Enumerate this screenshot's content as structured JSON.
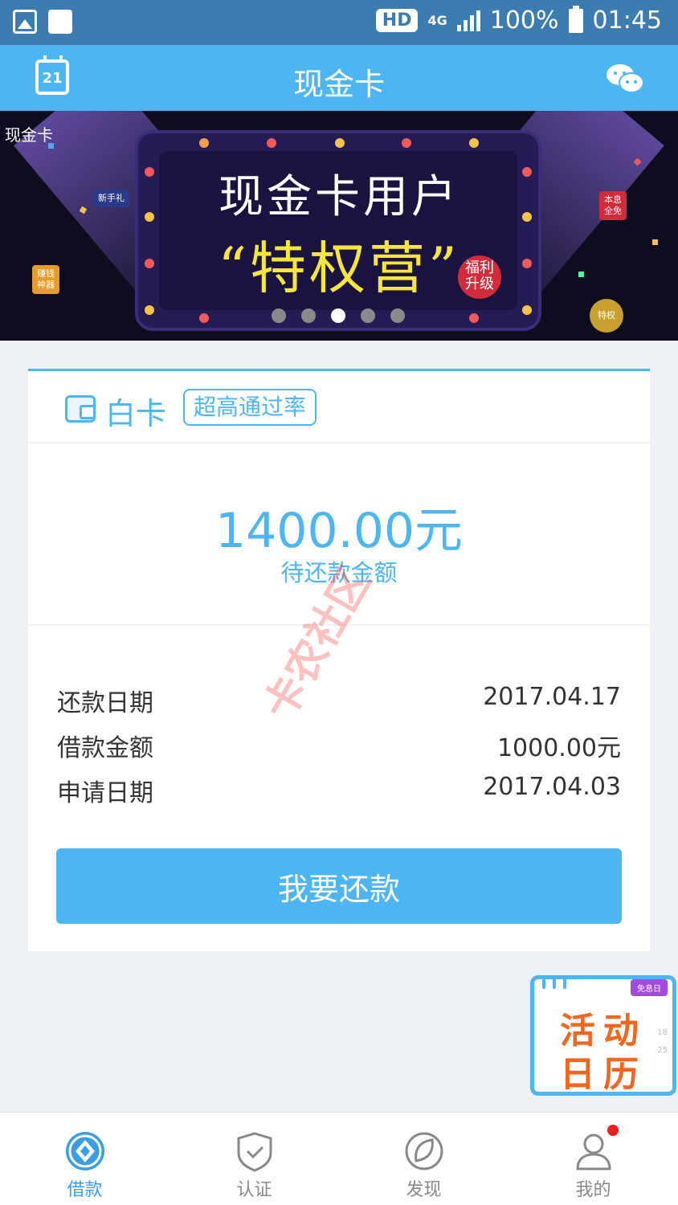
{
  "status_bar": {
    "hd": "HD",
    "network": "4G",
    "battery": "100%",
    "time": "01:45"
  },
  "header": {
    "title": "现金卡",
    "calendar_day": "21"
  },
  "banner": {
    "brand": "现金卡",
    "line1": "现金卡用户",
    "line2": "“特权营”",
    "badge_line1": "福利",
    "badge_line2": "升级",
    "sticker_left_top": "新手礼",
    "sticker_left_bottom_1": "赚钱",
    "sticker_left_bottom_2": "神器",
    "sticker_right_1": "本息",
    "sticker_right_2": "全免",
    "sticker_right_bottom": "特权",
    "slides": 5,
    "active_slide": 3
  },
  "card": {
    "name": "白卡",
    "tag": "超高通过率",
    "amount": "1400.00元",
    "amount_label": "待还款金额",
    "rows": [
      {
        "label": "还款日期",
        "value": "2017.04.17"
      },
      {
        "label": "借款金额",
        "value": "1000.00元"
      },
      {
        "label": "申请日期",
        "value": "2017.04.03"
      }
    ],
    "button": "我要还款"
  },
  "watermark": "卡农社区",
  "float_calendar": {
    "tag": "免息日",
    "line1": "活动",
    "line2": "日历",
    "nums": [
      "18",
      "25"
    ]
  },
  "nav": [
    {
      "label": "借款",
      "icon": "loan-icon",
      "active": true
    },
    {
      "label": "认证",
      "icon": "shield-check-icon",
      "active": false
    },
    {
      "label": "发现",
      "icon": "compass-leaf-icon",
      "active": false
    },
    {
      "label": "我的",
      "icon": "user-icon",
      "active": false,
      "badge": true
    }
  ],
  "colors": {
    "primary": "#4db6f2",
    "status_bar": "#3d7cb0",
    "background": "#eef1f5",
    "nav_active": "#3a9ee6",
    "badge_red": "#f21f1f"
  }
}
